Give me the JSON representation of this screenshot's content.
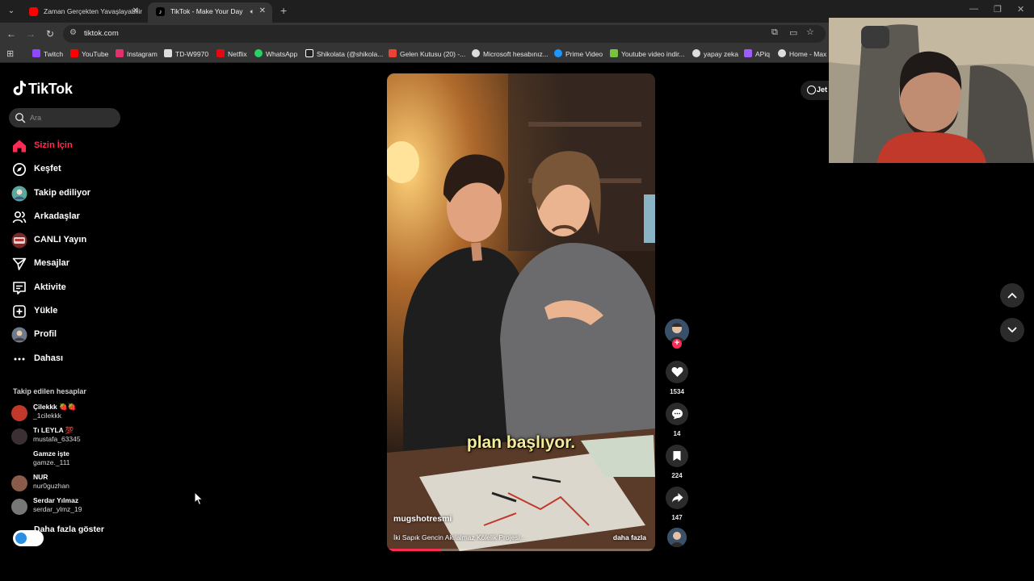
{
  "browser": {
    "tabs": [
      {
        "title": "Zaman Gerçekten Yavaşlayabilir",
        "active": false,
        "favicon": "youtube-icon"
      },
      {
        "title": "TikTok - Make Your Day",
        "active": true,
        "favicon": "tiktok-icon"
      }
    ],
    "url": "tiktok.com",
    "bookmarks": [
      {
        "label": "Twitch",
        "icon": "twitch-icon",
        "color": "#9146ff"
      },
      {
        "label": "YouTube",
        "icon": "youtube-icon",
        "color": "#ff0000"
      },
      {
        "label": "Instagram",
        "icon": "instagram-icon",
        "color": "#e1306c"
      },
      {
        "label": "TD-W9970",
        "icon": "router-icon",
        "color": "#dddddd"
      },
      {
        "label": "Netflix",
        "icon": "netflix-icon",
        "color": "#e50914"
      },
      {
        "label": "WhatsApp",
        "icon": "whatsapp-icon",
        "color": "#25d366"
      },
      {
        "label": "Shikolata (@shikola...",
        "icon": "tiktok-icon",
        "color": "#ffffff"
      },
      {
        "label": "Gelen Kutusu (20) -...",
        "icon": "gmail-icon",
        "color": "#ea4335"
      },
      {
        "label": "Microsoft hesabınız...",
        "icon": "microsoft-icon",
        "color": "#dddddd"
      },
      {
        "label": "Prime Video",
        "icon": "prime-video-icon",
        "color": "#1a98ff"
      },
      {
        "label": "Youtube video indir...",
        "icon": "download-icon",
        "color": "#7ac142"
      },
      {
        "label": "yapay zeka",
        "icon": "globe-icon",
        "color": "#dddddd"
      },
      {
        "label": "APiq",
        "icon": "apiq-icon",
        "color": "#a05cff"
      },
      {
        "label": "Home - Max",
        "icon": "max-icon",
        "color": "#dddddd"
      }
    ]
  },
  "tiktok": {
    "logo_text": "TikTok",
    "search_placeholder": "Ara",
    "nav": [
      {
        "label": "Sizin İçin",
        "icon": "home-icon",
        "active": true
      },
      {
        "label": "Keşfet",
        "icon": "compass-icon",
        "active": false
      },
      {
        "label": "Takip ediliyor",
        "icon": "following-avatar-icon",
        "active": false
      },
      {
        "label": "Arkadaşlar",
        "icon": "friends-icon",
        "active": false
      },
      {
        "label": "CANLI Yayın",
        "icon": "live-avatar-icon",
        "active": false
      },
      {
        "label": "Mesajlar",
        "icon": "send-icon",
        "active": false
      },
      {
        "label": "Aktivite",
        "icon": "activity-icon",
        "active": false
      },
      {
        "label": "Yükle",
        "icon": "upload-icon",
        "active": false
      },
      {
        "label": "Profil",
        "icon": "profile-avatar-icon",
        "active": false
      },
      {
        "label": "Dahası",
        "icon": "more-icon",
        "active": false
      }
    ],
    "following_title": "Takip edilen hesaplar",
    "following": [
      {
        "name": "Çilekkk 🍓🍓",
        "username": "_1cilekkk"
      },
      {
        "name": "Tı LEYLA 💯",
        "username": "mustafa_63345"
      },
      {
        "name": "Gamze işte",
        "username": "gamze._111"
      },
      {
        "name": "NUR",
        "username": "nur0guzhan"
      },
      {
        "name": "Serdar Yılmaz",
        "username": "serdar_ylmz_19"
      }
    ],
    "show_more": "Daha fazla göster",
    "get_app": "Jet",
    "video": {
      "caption": "plan başlıyor.",
      "author": "mugshotresmi",
      "description": "İki Sapık Gencin Akılalmaz Kölelik Projesi...",
      "more": "daha fazla",
      "progress": 0.2
    },
    "actions": {
      "likes": "1534",
      "comments": "14",
      "saves": "224",
      "shares": "147"
    }
  },
  "colors": {
    "accent": "#fe2c55",
    "caption": "#f3ec9a"
  }
}
